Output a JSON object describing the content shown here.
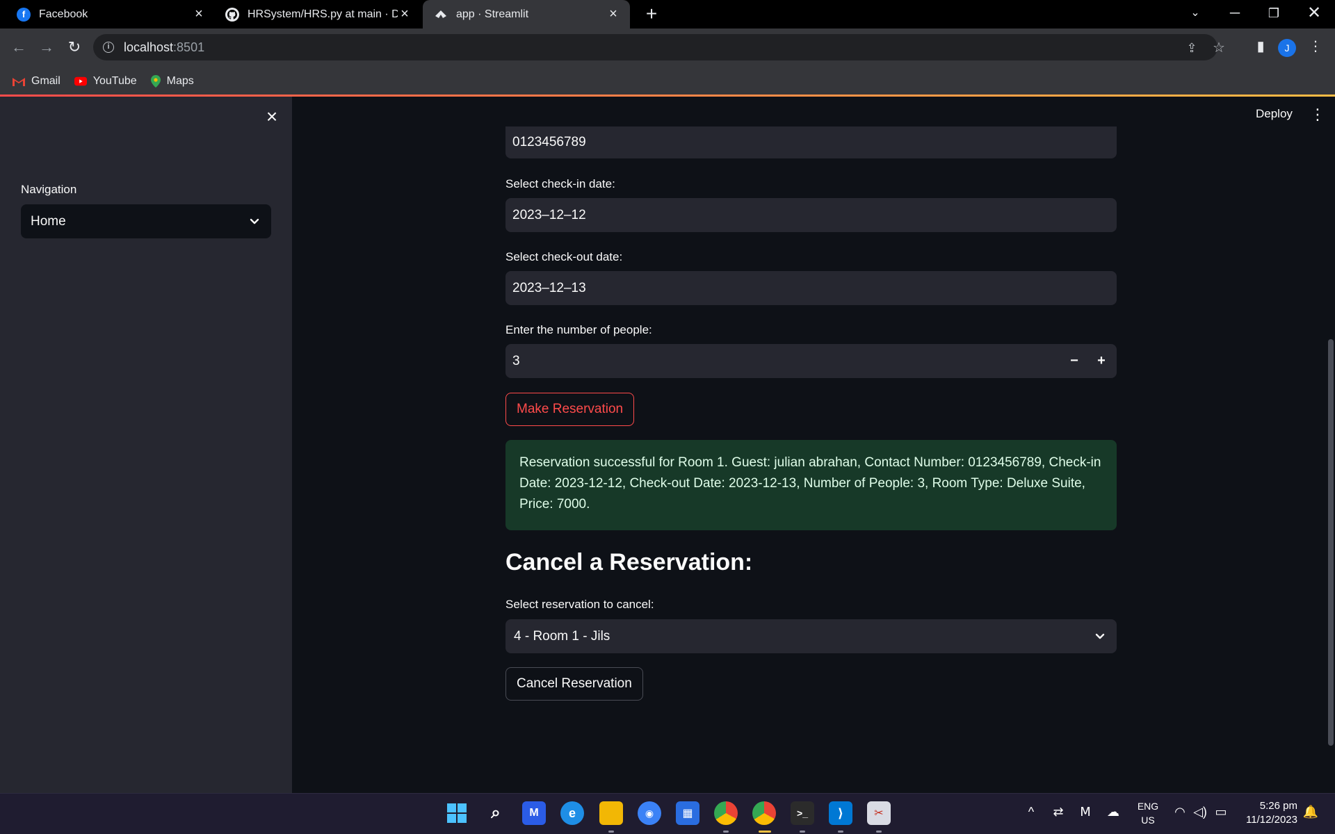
{
  "browser": {
    "tabs": [
      {
        "title": "Facebook",
        "favicon": "facebook-icon"
      },
      {
        "title": "HRSystem/HRS.py at main · Dext",
        "favicon": "github-icon"
      },
      {
        "title": "app · Streamlit",
        "favicon": "streamlit-icon",
        "active": true
      }
    ],
    "address": {
      "host": "localhost",
      "port": ":8501"
    },
    "bookmarks": [
      {
        "label": "Gmail",
        "icon": "gmail-icon"
      },
      {
        "label": "YouTube",
        "icon": "youtube-icon"
      },
      {
        "label": "Maps",
        "icon": "maps-icon"
      }
    ],
    "profile_initial": "J"
  },
  "sidebar": {
    "nav_label": "Navigation",
    "nav_selected": "Home"
  },
  "header": {
    "deploy_label": "Deploy"
  },
  "form": {
    "contact_value": "0123456789",
    "checkin_label": "Select check-in date:",
    "checkin_value": "2023–12–12",
    "checkout_label": "Select check-out date:",
    "checkout_value": "2023–12–13",
    "people_label": "Enter the number of people:",
    "people_value": "3",
    "minus": "−",
    "plus": "+",
    "make_button": "Make Reservation"
  },
  "success_message": "Reservation successful for Room 1. Guest: julian abrahan, Contact Number: 0123456789, Check-in Date: 2023-12-12, Check-out Date: 2023-12-13, Number of People: 3, Room Type: Deluxe Suite, Price: 7000.",
  "cancel": {
    "heading": "Cancel a Reservation:",
    "select_label": "Select reservation to cancel:",
    "selected": "4 - Room 1 - Jils",
    "button": "Cancel Reservation"
  },
  "taskbar": {
    "lang_top": "ENG",
    "lang_bottom": "US",
    "time": "5:26 pm",
    "date": "11/12/2023"
  },
  "colors": {
    "primary": "#ff4b4b",
    "success_bg": "#173928",
    "sidebar_bg": "#262730",
    "app_bg": "#0e1117"
  }
}
